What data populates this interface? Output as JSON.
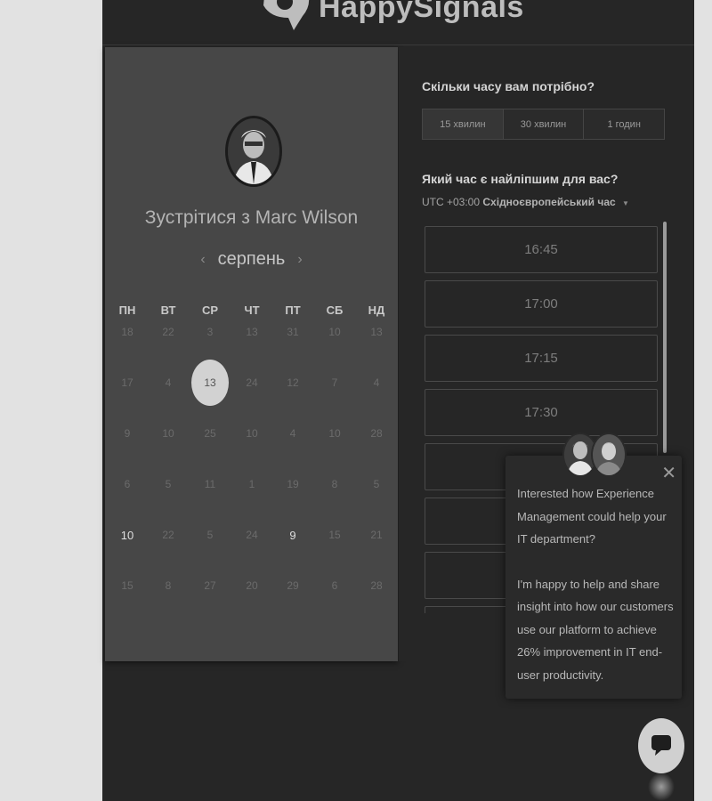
{
  "header": {
    "logo_text": "HappySignals",
    "logo_icon": "happysignals-logo-icon"
  },
  "calendar": {
    "meet_title": "Зустрітися з Marc Wilson",
    "month": "серпень",
    "prev_icon": "chevron-left-icon",
    "next_icon": "chevron-right-icon",
    "weekdays": [
      "ПН",
      "ВТ",
      "СР",
      "ЧТ",
      "ПТ",
      "СБ",
      "НД"
    ],
    "weeks": [
      [
        "18",
        "22",
        "3",
        "13",
        "31",
        "10",
        "13"
      ],
      [
        "17",
        "4",
        "13",
        "24",
        "12",
        "7",
        "4"
      ],
      [
        "9",
        "10",
        "25",
        "10",
        "4",
        "10",
        "28"
      ],
      [
        "6",
        "5",
        "11",
        "1",
        "19",
        "8",
        "5"
      ],
      [
        "10",
        "22",
        "5",
        "24",
        "9",
        "15",
        "21"
      ],
      [
        "15",
        "8",
        "27",
        "20",
        "29",
        "6",
        "28"
      ]
    ],
    "selected_day": "13"
  },
  "scheduler": {
    "duration_question": "Скільки часу вам потрібно?",
    "durations": [
      "15 хвилин",
      "30 хвилин",
      "1 годин"
    ],
    "active_duration": "15 хвилин",
    "time_question": "Який час є найліпшим для вас?",
    "timezone_offset": "UTC +03:00",
    "timezone_name": "Східноєвропейський час",
    "slots": [
      "16:45",
      "17:00",
      "17:15",
      "17:30",
      "",
      "",
      "",
      ""
    ]
  },
  "chat": {
    "message_1": "Interested how Experience Management could help your IT department?",
    "message_2": "I'm happy to help and share insight into how our customers use our platform to achieve 26% improvement in IT end-user productivity.",
    "close_icon": "close-icon",
    "launcher_icon": "chat-bubble-icon"
  },
  "colors": {
    "frame_bg": "#262626",
    "calendar_bg": "#474747",
    "outer_bg": "#e2e2e2"
  }
}
